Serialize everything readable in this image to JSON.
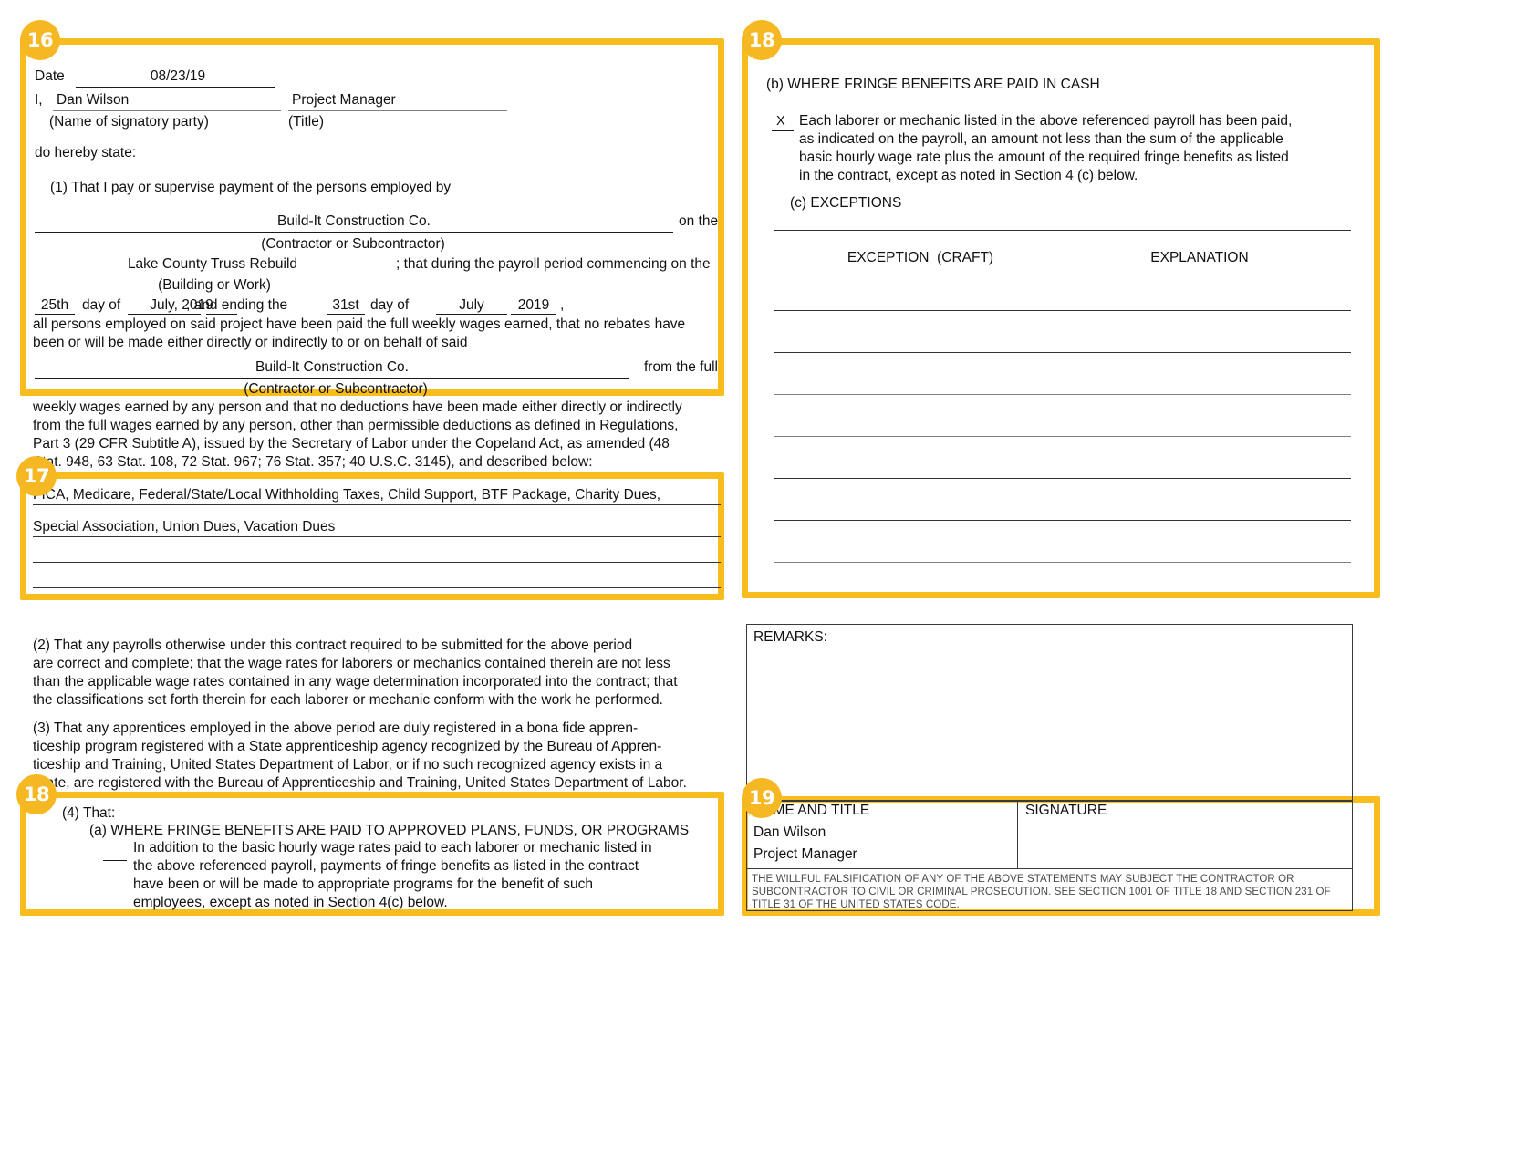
{
  "badges": [
    {
      "id": "16",
      "label": "16"
    },
    {
      "id": "17",
      "label": "17"
    },
    {
      "id": "18a",
      "label": "18"
    },
    {
      "id": "18b",
      "label": "18"
    },
    {
      "id": "19",
      "label": "19"
    }
  ],
  "left": {
    "date_label": "Date",
    "date_value": "08/23/19",
    "i_label": "I,",
    "signatory_name": "Dan Wilson",
    "signatory_title": "Project Manager",
    "name_caption": "(Name of signatory party)",
    "title_caption": "(Title)",
    "do_hereby": "do hereby state:",
    "item1": "(1) That I pay or supervise payment of the persons employed by",
    "contractor_1": "Build-It Construction Co.",
    "on_the": "on the",
    "contractor_caption_1": "(Contractor or Subcontractor)",
    "building_or_work": "Lake County Truss Rebuild",
    "during_period": "; that during the payroll period commencing on the",
    "building_caption": "(Building or Work)",
    "day_start": "25th",
    "day_of_1": "day of",
    "month_year_start": "July, 2019",
    "and_ending": ", and ending the",
    "day_end": "31st",
    "day_of_2": "day of",
    "month_end": "July",
    "year_end": "2019",
    "comma": ",",
    "para_a_line1": "all persons employed on said project have been paid the full weekly wages earned, that no rebates have",
    "para_a_line2": "been or will be made either directly or indirectly to or on behalf of said",
    "contractor_2": "Build-It Construction Co.",
    "from_the_full": "from the full",
    "contractor_caption_2": "(Contractor or Subcontractor)",
    "para_b_line1": "weekly wages earned by any person and that no deductions have been made either directly or indirectly",
    "para_b_line2": "from the full wages earned by any person, other than permissible deductions as defined in Regulations,",
    "para_b_line3": "Part 3 (29 CFR Subtitle A), issued by the Secretary of Labor under the Copeland Act, as amended (48",
    "para_b_line4": "Stat. 948, 63 Stat. 108, 72 Stat. 967; 76 Stat. 357; 40 U.S.C. 3145), and described below:",
    "deduction_line_1": "FICA, Medicare, Federal/State/Local Withholding Taxes, Child Support, BTF Package, Charity Dues,",
    "deduction_line_2": "Special Association, Union Dues, Vacation Dues",
    "deduction_line_3": "",
    "deduction_line_4": "",
    "item2_line1": "(2) That any payrolls otherwise under this contract required to be submitted for the above period",
    "item2_line2": "are correct and complete; that the wage rates for laborers or mechanics contained therein are not less",
    "item2_line3": "than the applicable wage rates contained in any wage determination incorporated into the contract; that",
    "item2_line4": "the classifications set forth therein for each laborer or mechanic conform with the work he performed.",
    "item3_line1": "(3) That any apprentices employed in the above period are duly registered in a bona fide appren-",
    "item3_line2": "ticeship program registered with a State apprenticeship agency recognized by the Bureau of Appren-",
    "item3_line3": "ticeship and Training, United States Department of Labor, or if no such recognized agency exists in a",
    "item3_line4": "State, are registered with the Bureau of Apprenticeship and Training, United States Department of Labor.",
    "item4_label": "(4) That:",
    "item4a_heading": "(a) WHERE FRINGE BENEFITS ARE PAID TO APPROVED PLANS, FUNDS, OR PROGRAMS",
    "item4a_line1": "In addition to the basic hourly wage rates paid to each laborer or mechanic listed in",
    "item4a_line2": "the above referenced payroll, payments of fringe benefits as listed in the contract",
    "item4a_line3": "have been or will be made to appropriate programs for the benefit of such",
    "item4a_line4": "employees, except as noted in Section 4(c) below."
  },
  "right": {
    "item4b_heading": "(b) WHERE FRINGE BENEFITS ARE PAID IN CASH",
    "checkmark": "X",
    "item4b_line1": "Each laborer or mechanic listed in the above referenced payroll has been paid,",
    "item4b_line2": "as indicated on the payroll, an amount not less than the sum of the applicable",
    "item4b_line3": "basic hourly wage rate plus the amount of the required fringe benefits as listed",
    "item4b_line4": "in the contract, except as noted in Section 4 (c) below.",
    "item4c_heading": "(c) EXCEPTIONS",
    "exceptions_table": {
      "columns": [
        "EXCEPTION  (CRAFT)",
        "EXPLANATION"
      ],
      "rows": [
        {
          "craft": "",
          "explanation": ""
        },
        {
          "craft": "",
          "explanation": ""
        },
        {
          "craft": "",
          "explanation": ""
        },
        {
          "craft": "",
          "explanation": ""
        },
        {
          "craft": "",
          "explanation": ""
        },
        {
          "craft": "",
          "explanation": ""
        },
        {
          "craft": "",
          "explanation": ""
        }
      ]
    },
    "remarks_label": "REMARKS:",
    "remarks_value": "",
    "name_and_title_label": "NAME AND TITLE",
    "signature_label": "SIGNATURE",
    "name_value": "Dan Wilson",
    "title_value": "Project Manager",
    "signature_value": "",
    "warning_line1": "THE WILLFUL FALSIFICATION OF ANY OF THE ABOVE STATEMENTS MAY SUBJECT THE CONTRACTOR OR",
    "warning_line2": "SUBCONTRACTOR TO CIVIL OR CRIMINAL PROSECUTION. SEE SECTION 1001 OF TITLE 18 AND SECTION 231 OF",
    "warning_line3": "TITLE 31 OF THE UNITED STATES CODE."
  },
  "colors": {
    "highlight": "#F7BD1C",
    "badge": "#F5B722",
    "rule": "#1a1a1a",
    "rule_gray": "#808080"
  }
}
